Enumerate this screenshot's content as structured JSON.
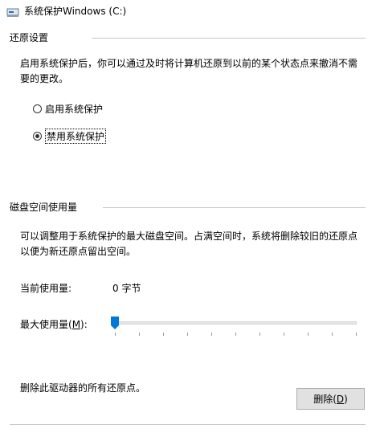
{
  "window": {
    "title": "系统保护Windows (C:)"
  },
  "restore_settings": {
    "group_label": "还原设置",
    "description_line1": "启用系统保护后，你可以通过及时将计算机还原到以前的某个状态点来撤消不需",
    "description_line2": "要的更改。",
    "options": [
      {
        "label": "启用系统保护",
        "selected": false
      },
      {
        "label": "禁用系统保护",
        "selected": true
      }
    ]
  },
  "disk_usage": {
    "group_label": "磁盘空间使用量",
    "description_line1": "可以调整用于系统保护的最大磁盘空间。占满空间时，系统将删除较旧的还原点",
    "description_line2": "以便为新还原点留出空间。",
    "current_usage_label": "当前使用量:",
    "current_usage_value": "0 字节",
    "max_usage_label_prefix": "最大使用量(",
    "max_usage_label_key": "M",
    "max_usage_label_suffix": "):",
    "max_usage_slider_fraction": 0.0
  },
  "delete_section": {
    "description": "删除此驱动器的所有还原点。",
    "button_prefix": "删除(",
    "button_key": "D",
    "button_suffix": ")"
  },
  "colors": {
    "accent_blue": "#0078d7",
    "group_line": "#c8c8c8",
    "button_bg": "#e1e1e1"
  }
}
